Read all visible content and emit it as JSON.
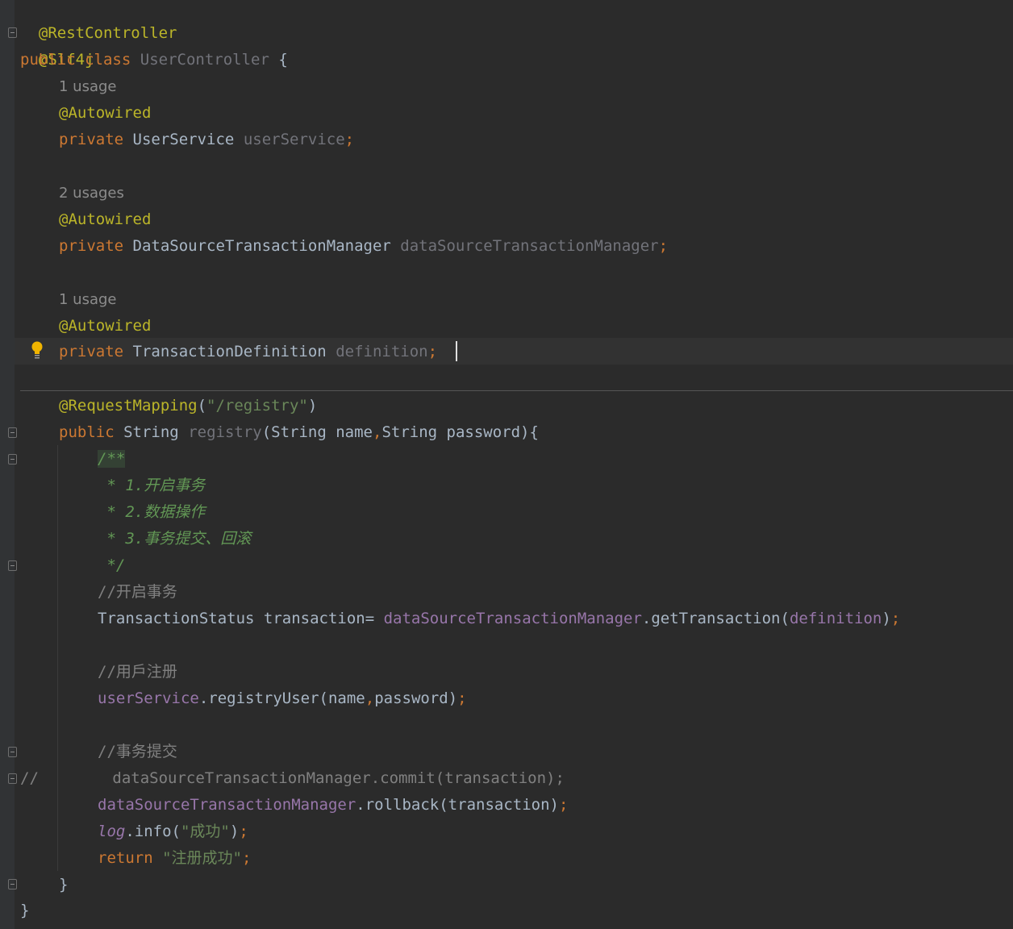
{
  "code": {
    "l1": "@RestController",
    "l2": "@Slf4j",
    "l3_kw1": "public",
    "l3_kw2": "class",
    "l3_name": "UserController",
    "l3_brace": " {",
    "hint1": "1 usage",
    "ann_autowired": "@Autowired",
    "kw_private": "private",
    "f1_type": "UserService",
    "f1_name": "userService",
    "semi": ";",
    "hint2": "2 usages",
    "f2_type": "DataSourceTransactionManager",
    "f2_name": "dataSourceTransactionManager",
    "hint3": "1 usage",
    "f3_type": "TransactionDefinition",
    "f3_name": "definition",
    "rm_ann": "@RequestMapping",
    "rm_open": "(",
    "rm_str": "\"/registry\"",
    "rm_close": ")",
    "m_public": "public",
    "m_ret": "String",
    "m_name": "registry",
    "m_params1": "(String name",
    "m_comma": ",",
    "m_params2": "String password){",
    "doc_open": "/**",
    "doc_l1": " * 1.开启事务",
    "doc_l2": " * 2.数据操作",
    "doc_l3": " * 3.事务提交、回滚",
    "doc_close": " */",
    "c1": "//开启事务",
    "ts_type": "TransactionStatus transaction= ",
    "ts_field": "dataSourceTransactionManager",
    "ts_call": ".getTransaction(",
    "ts_arg": "definition",
    "ts_close": ")",
    "c2": "//用戶注册",
    "us_field": "userService",
    "us_call": ".registryUser(name",
    "us_comma": ",",
    "us_tail": "password)",
    "c3": "//事务提交",
    "cm_prefix": "//",
    "cm_body": "        dataSourceTransactionManager.commit(transaction);",
    "rb_field": "dataSourceTransactionManager",
    "rb_call": ".rollback(transaction)",
    "log_var": "log",
    "log_call": ".info(",
    "log_str": "\"成功\"",
    "log_close": ")",
    "ret_kw": "return",
    "ret_str": "\"注册成功\"",
    "m_close": "}",
    "cls_close": "}"
  },
  "icons": {
    "intention": "lightbulb-icon",
    "fold": "fold-marker-icon"
  },
  "colors": {
    "background": "#2b2b2b",
    "annotation": "#bbb529",
    "keyword": "#cc7832",
    "field": "#9876aa",
    "string": "#6a8759",
    "comment": "#808080",
    "doc_comment": "#629755"
  }
}
